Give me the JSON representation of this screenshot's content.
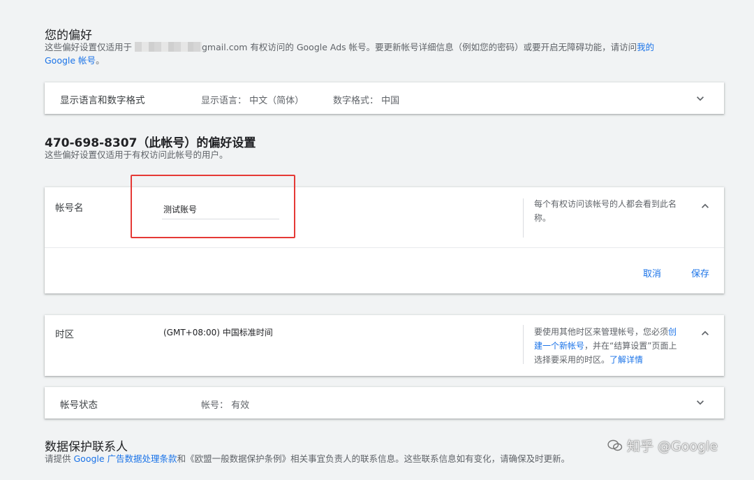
{
  "prefs": {
    "title": "您的偏好",
    "desc_part1": "这些偏好设置仅适用于",
    "desc_part2": "gmail.com 有权访问的 Google Ads 帐号。要更新帐号详细信息（例如您的密码）或要开启无障碍功能，请访问",
    "desc_link": "我的",
    "desc_link2": "Google 帐号",
    "desc_end": "。"
  },
  "language_card": {
    "label": "显示语言和数字格式",
    "display_language": "显示语言：  中文（简体）",
    "number_format": "数字格式：  中国"
  },
  "account_section": {
    "title": "470-698-8307（此帐号）的偏好设置",
    "desc": "这些偏好设置仅适用于有权访问此帐号的用户。"
  },
  "name_card": {
    "label": "帐号名",
    "value": "测试账号",
    "help": "每个有权访问该帐号的人都会看到此名称。",
    "cancel": "取消",
    "save": "保存"
  },
  "timezone_card": {
    "label": "时区",
    "value": "(GMT+08:00) 中国标准时间",
    "help_part1": "要使用其他时区来管理帐号，您必须",
    "help_link1": "创建一个新帐号",
    "help_part2": "，并在“结算设置”页面上选择要采用的时区。",
    "help_link2": "了解详情"
  },
  "status_card": {
    "label": "帐号状态",
    "value": "帐号：  有效"
  },
  "data_protection": {
    "title": "数据保护联系人",
    "desc_part1": "请提供",
    "desc_link": "Google 广告数据处理条款",
    "desc_part2": "和《欧盟一般数据保护条例》相关事宜负责人的联系信息。这些联系信息如有变化，请确保及时更新。"
  },
  "watermark": "知乎 @Google"
}
